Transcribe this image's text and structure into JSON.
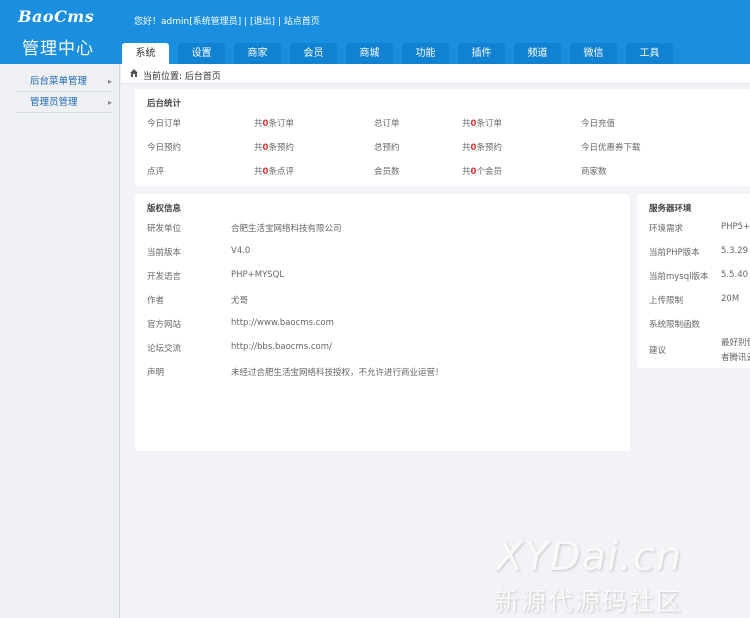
{
  "brand": {
    "logo": "BaoCms",
    "title": "管理中心"
  },
  "header": {
    "greeting": "您好！admin[系统管理员]",
    "sep1": " | ",
    "logout": "[退出]",
    "sep2": " | ",
    "home_link": "站点首页"
  },
  "tabs": [
    "系统",
    "设置",
    "商家",
    "会员",
    "商城",
    "功能",
    "插件",
    "频道",
    "微信",
    "工具"
  ],
  "sidebar": {
    "items": [
      {
        "label": "后台菜单管理"
      },
      {
        "label": "管理员管理"
      }
    ]
  },
  "breadcrumb": "当前位置: 后台首页",
  "stats": {
    "title": "后台统计",
    "rows": [
      [
        {
          "label": "今日订单"
        },
        {
          "pre": "共",
          "num": "0",
          "post": "条订单"
        },
        {
          "label": "总订单"
        },
        {
          "pre": "共",
          "num": "0",
          "post": "条订单"
        },
        {
          "label": "今日充值"
        }
      ],
      [
        {
          "label": "今日预约"
        },
        {
          "pre": "共",
          "num": "0",
          "post": "条预约"
        },
        {
          "label": "总预约"
        },
        {
          "pre": "共",
          "num": "0",
          "post": "条预约"
        },
        {
          "label": "今日优惠券下载"
        }
      ],
      [
        {
          "label": "点评"
        },
        {
          "pre": "共",
          "num": "0",
          "post": "条点评"
        },
        {
          "label": "会员数"
        },
        {
          "pre": "共",
          "num": "0",
          "post": "个会员"
        },
        {
          "label": "商家数"
        }
      ]
    ]
  },
  "copyright": {
    "title": "版权信息",
    "rows": [
      {
        "label": "研发单位",
        "value": "合肥生活宝网络科技有限公司"
      },
      {
        "label": "当前版本",
        "value": "V4.0"
      },
      {
        "label": "开发语言",
        "value": "PHP+MYSQL"
      },
      {
        "label": "作者",
        "value": "尤哥"
      },
      {
        "label": "官方网站",
        "value": "http://www.baocms.com"
      },
      {
        "label": "论坛交流",
        "value": "http://bbs.baocms.com/"
      },
      {
        "label": "声明",
        "value": "未经过合肥生活宝网络科技授权，不允许进行商业运营！"
      }
    ]
  },
  "server": {
    "title": "服务器环境",
    "rows": [
      {
        "label": "环境需求",
        "value": "PHP5+"
      },
      {
        "label": "当前PHP版本",
        "value": "5.3.29"
      },
      {
        "label": "当前mysql版本",
        "value": "5.5.40"
      },
      {
        "label": "上传限制",
        "value": "20M"
      },
      {
        "label": "系统限制函数",
        "value": ""
      },
      {
        "label": "建议",
        "value": "最好别使",
        "value2": "者腾讯云"
      }
    ]
  },
  "watermark": {
    "line1": "XYDai.cn",
    "line2": "新源代源码社区"
  },
  "colors": {
    "header_bg": "#1a8fe0",
    "tab_bg": "#1181d2",
    "accent_red": "#e03030",
    "link_blue": "#1a66b0"
  }
}
